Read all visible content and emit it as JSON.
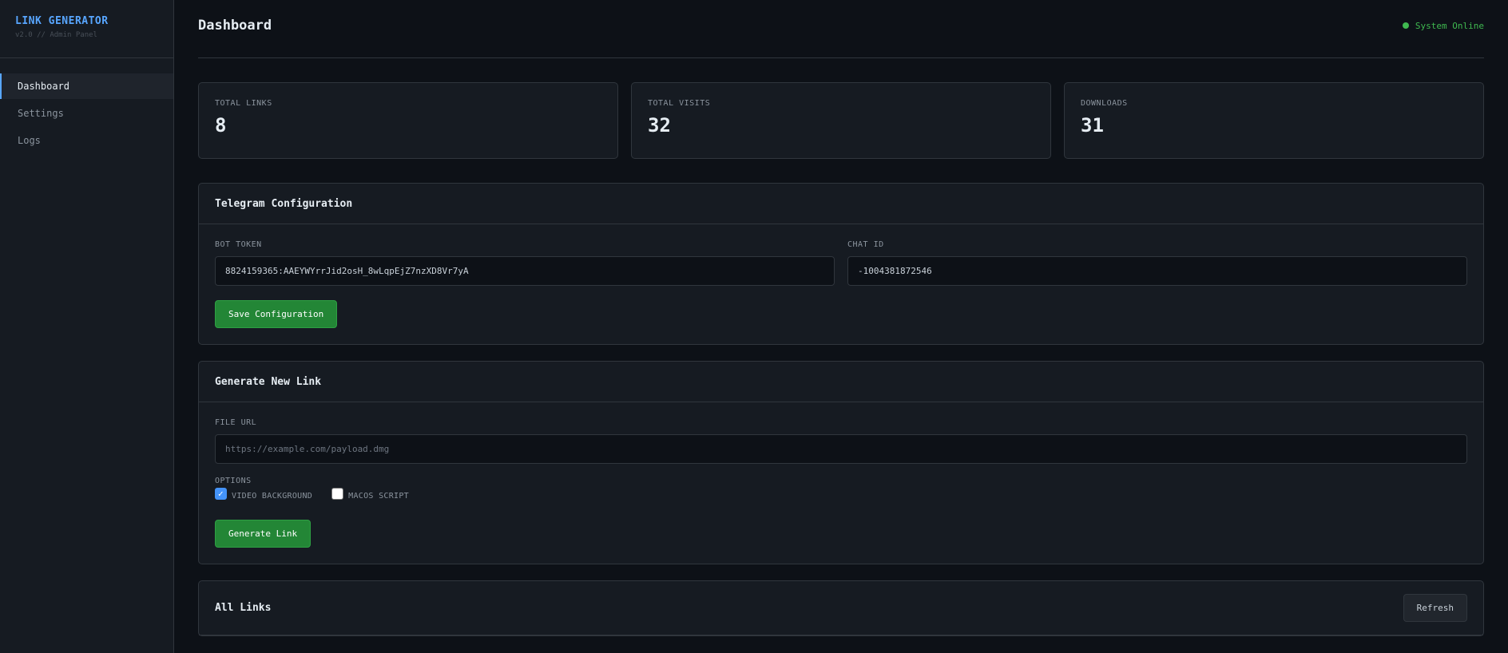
{
  "sidebar": {
    "brand_title": "LINK GENERATOR",
    "brand_subtitle": "v2.0 // Admin Panel",
    "items": [
      {
        "label": "Dashboard",
        "active": true
      },
      {
        "label": "Settings",
        "active": false
      },
      {
        "label": "Logs",
        "active": false
      }
    ]
  },
  "header": {
    "title": "Dashboard",
    "status": "System Online",
    "status_color": "#3fb950"
  },
  "stats": [
    {
      "label": "TOTAL LINKS",
      "value": "8"
    },
    {
      "label": "TOTAL VISITS",
      "value": "32"
    },
    {
      "label": "DOWNLOADS",
      "value": "31"
    }
  ],
  "telegram": {
    "title": "Telegram Configuration",
    "bot_token_label": "BOT TOKEN",
    "bot_token_value": "8824159365:AAEYWYrrJid2osH_8wLqpEjZ7nzXD8Vr7yA",
    "chat_id_label": "CHAT ID",
    "chat_id_value": "-1004381872546",
    "save_label": "Save Configuration"
  },
  "generate": {
    "title": "Generate New Link",
    "file_url_label": "FILE URL",
    "file_url_value": "",
    "file_url_placeholder": "https://example.com/payload.dmg",
    "options_label": "OPTIONS",
    "options": [
      {
        "label": "VIDEO BACKGROUND",
        "checked": true
      },
      {
        "label": "MACOS SCRIPT",
        "checked": false
      }
    ],
    "generate_label": "Generate Link"
  },
  "all_links": {
    "title": "All Links",
    "refresh_label": "Refresh"
  },
  "colors": {
    "accent": "#58a6ff",
    "primary_button": "#238636",
    "background": "#0d1117",
    "panel": "#161b22"
  }
}
